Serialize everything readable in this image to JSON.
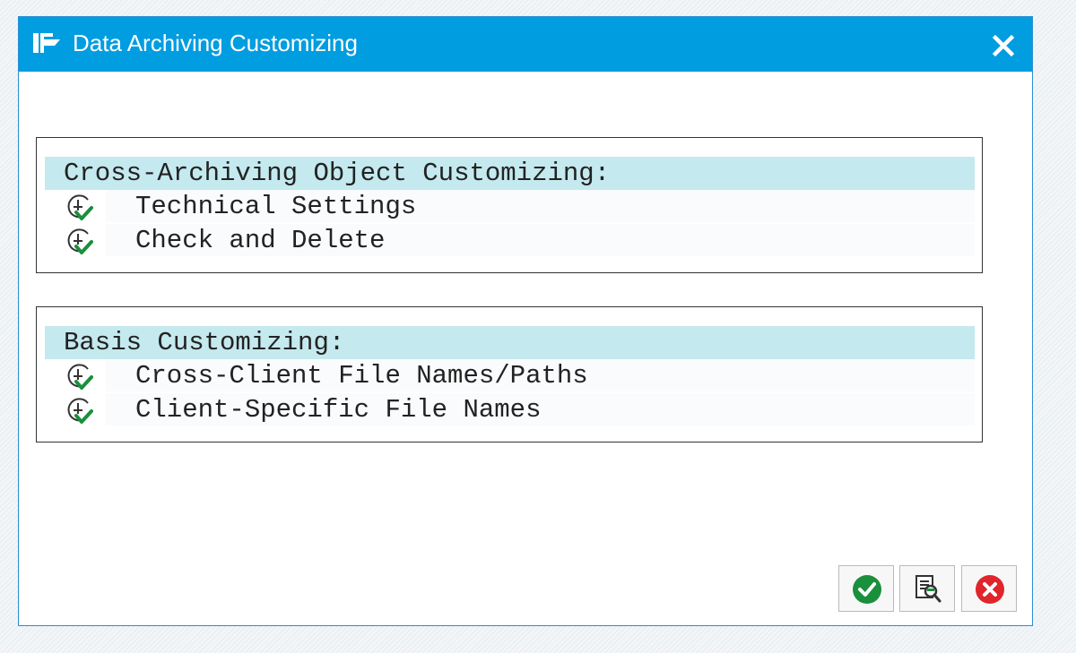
{
  "window": {
    "title": "Data Archiving Customizing",
    "title_icon": "dialog-flag-icon",
    "close_icon": "close-icon"
  },
  "groups": [
    {
      "header": "Cross-Archiving Object Customizing:",
      "items": [
        {
          "label": "Technical Settings",
          "icon": "execute-clock-check-icon"
        },
        {
          "label": "Check and Delete",
          "icon": "execute-clock-check-icon"
        }
      ]
    },
    {
      "header": "Basis Customizing:",
      "items": [
        {
          "label": "Cross-Client File Names/Paths",
          "icon": "execute-clock-check-icon"
        },
        {
          "label": "Client-Specific File Names",
          "icon": "execute-clock-check-icon"
        }
      ]
    }
  ],
  "footer": {
    "buttons": [
      {
        "icon": "confirm-check-icon"
      },
      {
        "icon": "document-search-icon"
      },
      {
        "icon": "cancel-x-icon"
      }
    ]
  },
  "colors": {
    "titlebar": "#009de0",
    "group_header_bg": "#c4e9ee",
    "confirm_green": "#1a8f3c",
    "cancel_red": "#e0252b"
  }
}
